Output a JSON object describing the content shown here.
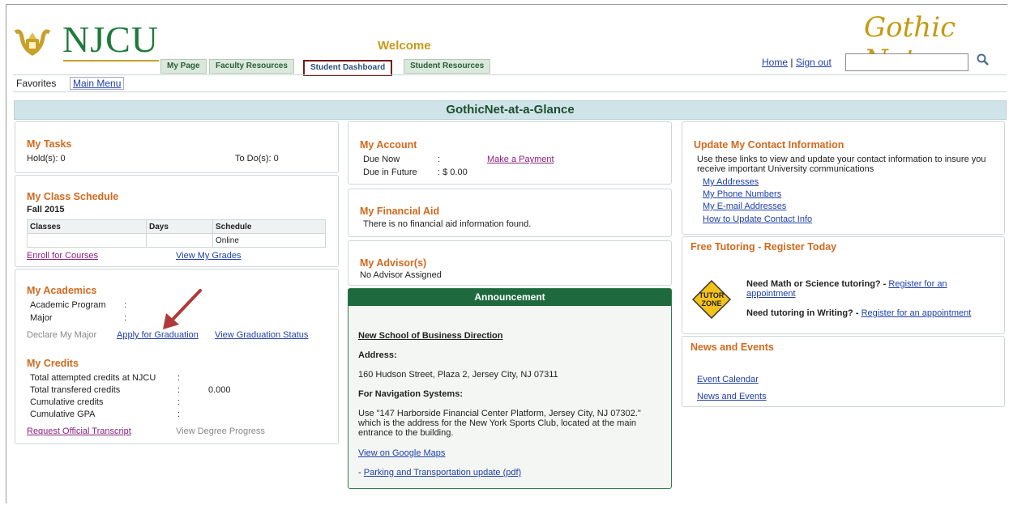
{
  "header": {
    "logo_text": "NJCU",
    "welcome": "Welcome",
    "brand": "Gothic Net",
    "tabs": [
      "My Page",
      "Faculty Resources",
      "Student Dashboard",
      "Student Resources"
    ],
    "home_link": "Home",
    "separator": "|",
    "signout_link": "Sign out",
    "search_value": ""
  },
  "nav": {
    "favorites": "Favorites",
    "main_menu": "Main Menu"
  },
  "banner": "GothicNet-at-a-Glance",
  "tasks": {
    "title": "My Tasks",
    "holds": "Hold(s): 0",
    "todos": "To Do(s): 0"
  },
  "schedule": {
    "title": "My Class Schedule",
    "term": "Fall 2015",
    "columns": [
      "Classes",
      "Days",
      "Schedule"
    ],
    "rows": [
      [
        "",
        "",
        "Online"
      ]
    ],
    "enroll": "Enroll for Courses",
    "grades": "View My Grades"
  },
  "academics": {
    "title": "My Academics",
    "program_label": "Academic Program",
    "program_sep": ":",
    "major_label": "Major",
    "major_sep": ":",
    "declare": "Declare My Major",
    "apply": "Apply for Graduation",
    "status": "View Graduation Status"
  },
  "credits": {
    "title": "My Credits",
    "rows": [
      {
        "label": "Total attempted credits at NJCU",
        "sep": ":",
        "value": ""
      },
      {
        "label": "Total transfered credits",
        "sep": ":",
        "value": "0.000"
      },
      {
        "label": "Cumulative credits",
        "sep": ":",
        "value": ""
      },
      {
        "label": "Cumulative GPA",
        "sep": ":",
        "value": ""
      }
    ],
    "transcript": "Request Official Transcript",
    "degree": "View Degree Progress"
  },
  "account": {
    "title": "My Account",
    "due_now_label": "Due Now",
    "due_now_sep": ":",
    "due_future_label": "Due in Future",
    "due_future_value": ": $ 0.00",
    "pay": "Make a Payment"
  },
  "aid": {
    "title": "My Financial Aid",
    "text": "There is no financial aid information found."
  },
  "advisor": {
    "title": "My Advisor(s)",
    "text": "No Advisor Assigned"
  },
  "announcement": {
    "title": "Announcement",
    "heading": "New School of Business Direction",
    "address_label": "Address:",
    "address": "160 Hudson Street, Plaza 2, Jersey City, NJ 07311",
    "nav_label": "For Navigation Systems:",
    "nav_text": "Use \"147 Harborside Financial Center Platform, Jersey City, NJ 07302.\" which is the address for the New York Sports Club, located at the main entrance to the building.",
    "maps": "View on Google Maps",
    "parking_prefix": "- ",
    "parking": "Parking and Transportation update (pdf)"
  },
  "contact": {
    "title": "Update My Contact Information",
    "text": "Use these links to view and update your contact information to insure you receive important University communications",
    "links": [
      "My Addresses",
      "My Phone Numbers",
      "My E-mail Addresses",
      "How to Update Contact Info"
    ]
  },
  "tutoring": {
    "title": "Free Tutoring - Register Today",
    "sign_line1": "TUTOR",
    "sign_line2": "ZONE",
    "q1": "Need Math or Science tutoring? - ",
    "q1_link": "Register for an appointment",
    "q2": "Need tutoring in Writing? - ",
    "q2_link": "Register for an appointment"
  },
  "news": {
    "title": "News and Events",
    "links": [
      "Event Calendar",
      "News and Events"
    ]
  },
  "colors": {
    "green": "#1e7a3a",
    "gold": "#c49a12",
    "orange": "#d2691e",
    "link": "#1f3fa8",
    "tab_highlight": "#7a1818",
    "annotation_arrow": "#b03a3a"
  }
}
